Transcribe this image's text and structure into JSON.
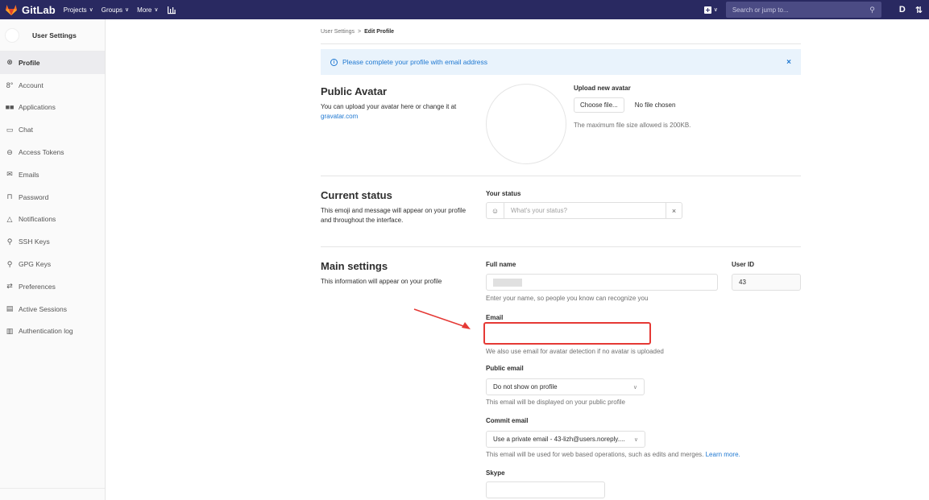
{
  "topbar": {
    "brand": "GitLab",
    "nav": [
      "Projects",
      "Groups",
      "More"
    ],
    "search_placeholder": "Search or jump to...",
    "right_icons": [
      "D",
      "⇅"
    ]
  },
  "sidebar": {
    "title": "User Settings",
    "items": [
      {
        "label": "Profile",
        "icon": "user-circle-icon",
        "glyph": "⊗",
        "active": true
      },
      {
        "label": "Account",
        "icon": "account-icon",
        "glyph": "8°"
      },
      {
        "label": "Applications",
        "icon": "applications-icon",
        "glyph": "■■"
      },
      {
        "label": "Chat",
        "icon": "chat-icon",
        "glyph": "▭"
      },
      {
        "label": "Access Tokens",
        "icon": "token-icon",
        "glyph": "⊖"
      },
      {
        "label": "Emails",
        "icon": "email-icon",
        "glyph": "✉"
      },
      {
        "label": "Password",
        "icon": "lock-icon",
        "glyph": "⊓"
      },
      {
        "label": "Notifications",
        "icon": "bell-icon",
        "glyph": "△"
      },
      {
        "label": "SSH Keys",
        "icon": "key-icon",
        "glyph": "⚲"
      },
      {
        "label": "GPG Keys",
        "icon": "gpg-key-icon",
        "glyph": "⚲"
      },
      {
        "label": "Preferences",
        "icon": "preferences-icon",
        "glyph": "⇄"
      },
      {
        "label": "Active Sessions",
        "icon": "monitor-icon",
        "glyph": "▤"
      },
      {
        "label": "Authentication log",
        "icon": "log-icon",
        "glyph": "▥"
      }
    ]
  },
  "breadcrumb": {
    "parent": "User Settings",
    "separator": ">",
    "current": "Edit Profile"
  },
  "alert": {
    "text": "Please complete your profile with email address",
    "close": "×"
  },
  "avatar_section": {
    "title": "Public Avatar",
    "desc": "You can upload your avatar here or change it at",
    "link": "gravatar.com",
    "upload_label": "Upload new avatar",
    "choose_button": "Choose file...",
    "no_file": "No file chosen",
    "help": "The maximum file size allowed is 200KB."
  },
  "status_section": {
    "title": "Current status",
    "desc": "This emoji and message will appear on your profile and throughout the interface.",
    "label": "Your status",
    "placeholder": "What's your status?",
    "clear": "×"
  },
  "main_section": {
    "title": "Main settings",
    "desc": "This information will appear on your profile",
    "full_name_label": "Full name",
    "full_name_help": "Enter your name, so people you know can recognize you",
    "user_id_label": "User ID",
    "user_id_value": "43",
    "email_label": "Email",
    "email_value": "",
    "email_help": "We also use email for avatar detection if no avatar is uploaded",
    "public_email_label": "Public email",
    "public_email_value": "Do not show on profile",
    "public_email_help": "This email will be displayed on your public profile",
    "commit_email_label": "Commit email",
    "commit_email_value": "Use a private email - 43-lizh@users.noreply....",
    "commit_email_help": "This email will be used for web based operations, such as edits and merges.",
    "commit_email_link": "Learn more.",
    "skype_label": "Skype"
  }
}
